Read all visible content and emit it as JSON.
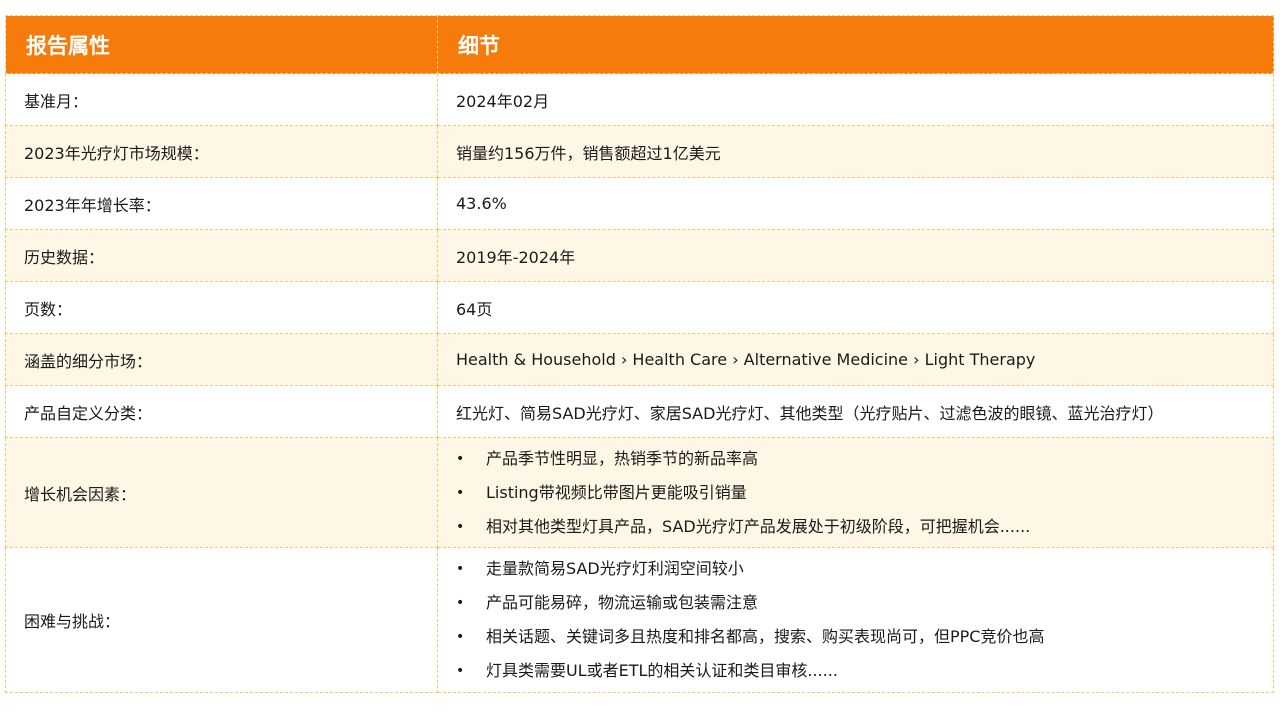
{
  "header": {
    "col1": "报告属性",
    "col2": "细节"
  },
  "rows": [
    {
      "label": "基准月：",
      "value": "2024年02月"
    },
    {
      "label": "2023年光疗灯市场规模：",
      "value": "销量约156万件，销售额超过1亿美元"
    },
    {
      "label": "2023年年增长率：",
      "value": "43.6%"
    },
    {
      "label": "历史数据：",
      "value": "2019年-2024年"
    },
    {
      "label": "页数：",
      "value": "64页"
    },
    {
      "label": "涵盖的细分市场：",
      "value": "Health & Household › Health Care › Alternative Medicine › Light Therapy"
    },
    {
      "label": "产品自定义分类：",
      "value": "红光灯、简易SAD光疗灯、家居SAD光疗灯、其他类型（光疗贴片、过滤色波的眼镜、蓝光治疗灯）"
    }
  ],
  "growth": {
    "label": "增长机会因素：",
    "items": [
      "产品季节性明显，热销季节的新品率高",
      "Listing带视频比带图片更能吸引销量",
      "相对其他类型灯具产品，SAD光疗灯产品发展处于初级阶段，可把握机会......"
    ]
  },
  "challenges": {
    "label": "困难与挑战：",
    "items": [
      "走量款简易SAD光疗灯利润空间较小",
      "产品可能易碎，物流运输或包装需注意",
      "相关话题、关键词多且热度和排名都高，搜索、购买表现尚可，但PPC竞价也高",
      "灯具类需要UL或者ETL的相关认证和类目审核......"
    ]
  },
  "colors": {
    "header_bg": "#f67b0a",
    "stripe_bg": "#fff7e6",
    "border": "#f8c766"
  }
}
